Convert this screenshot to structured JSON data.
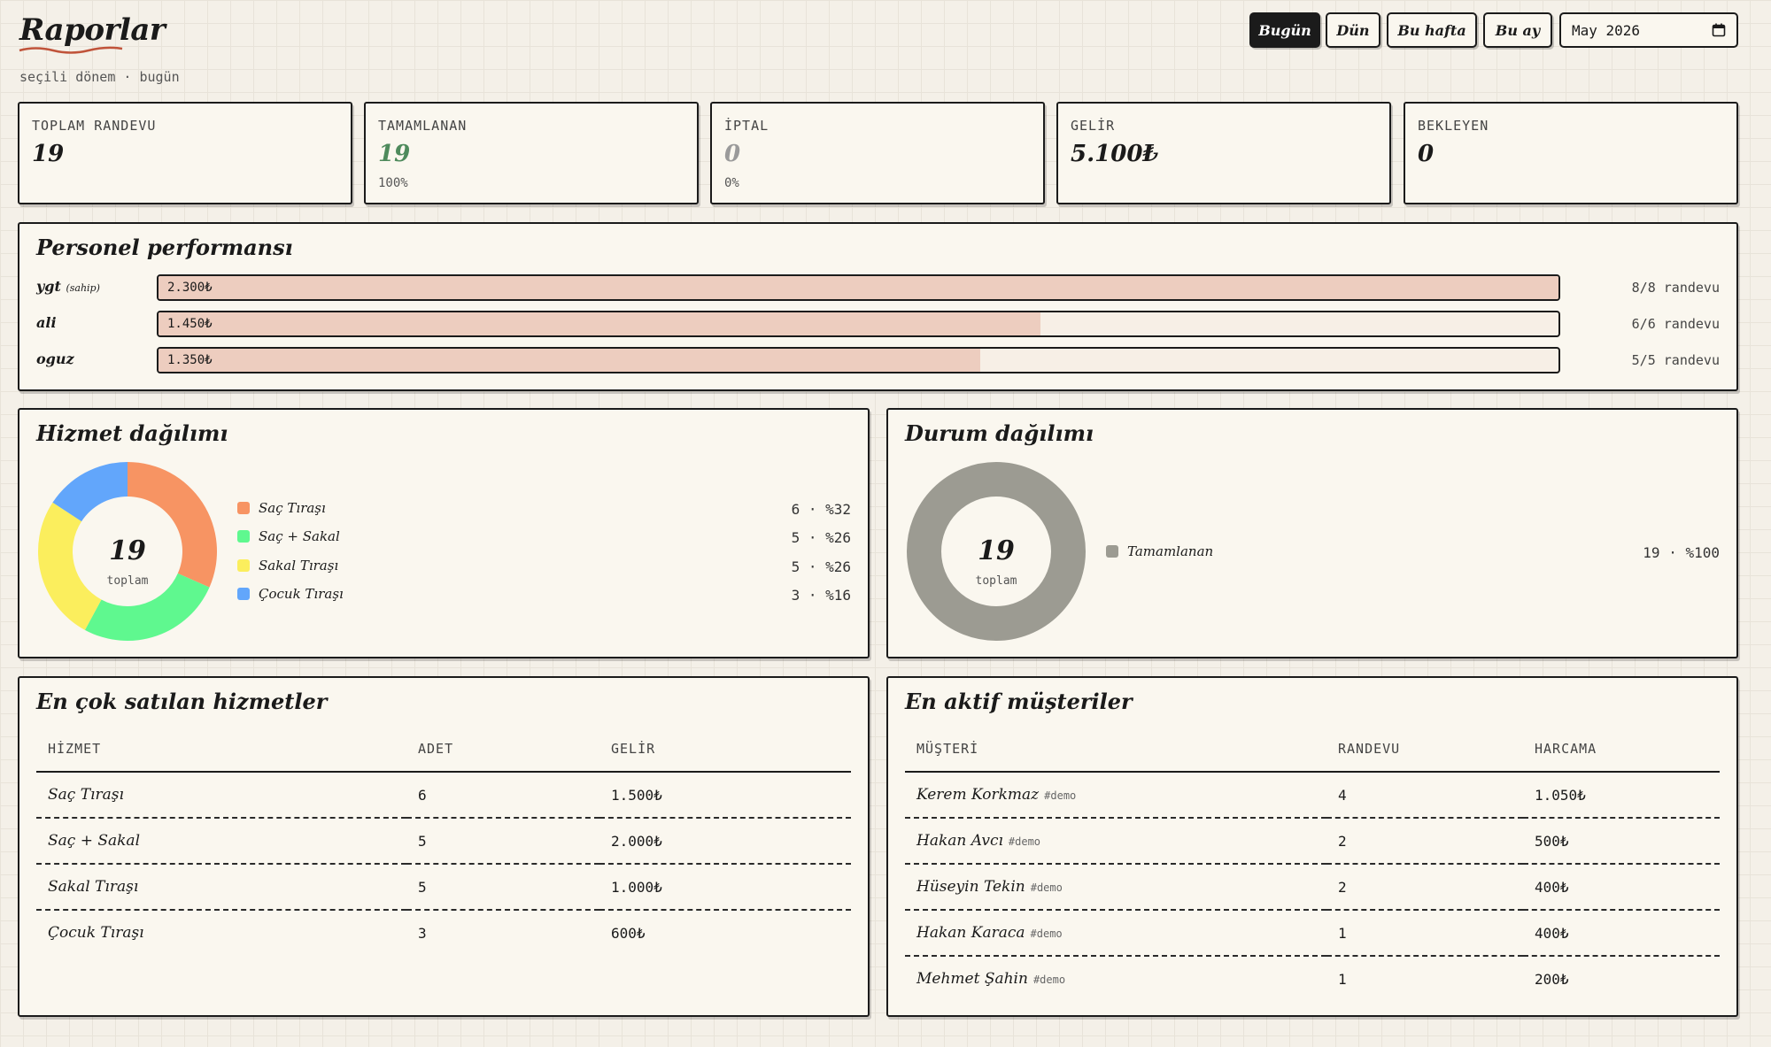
{
  "header": {
    "title": "Raporlar",
    "subtitle": "seçili dönem · bugün",
    "accent": "#c0533a"
  },
  "controls": {
    "buttons": [
      {
        "label": "Bugün",
        "active": true
      },
      {
        "label": "Dün",
        "active": false
      },
      {
        "label": "Bu hafta",
        "active": false
      },
      {
        "label": "Bu ay",
        "active": false
      }
    ],
    "date_value": "May 2026",
    "calendar_icon": "calendar-icon"
  },
  "stats": [
    {
      "label": "TOPLAM RANDEVU",
      "value": "19",
      "sub": "",
      "color": "#1a1a1a"
    },
    {
      "label": "TAMAMLANAN",
      "value": "19",
      "sub": "100%",
      "color": "#4e8a5c"
    },
    {
      "label": "İPTAL",
      "value": "0",
      "sub": "0%",
      "color": "#9a9a9a"
    },
    {
      "label": "GELİR",
      "value": "5.100₺",
      "sub": "",
      "color": "#1a1a1a"
    },
    {
      "label": "BEKLEYEN",
      "value": "0",
      "sub": "",
      "color": "#1a1a1a"
    }
  ],
  "performance": {
    "title": "Personel performansı",
    "rows": [
      {
        "name": "ygt",
        "role": "(sahip)",
        "amount": "2.300₺",
        "fraction": 1.0,
        "count": "8/8 randevu"
      },
      {
        "name": "ali",
        "role": "",
        "amount": "1.450₺",
        "fraction": 0.63,
        "count": "6/6 randevu"
      },
      {
        "name": "oguz",
        "role": "",
        "amount": "1.350₺",
        "fraction": 0.587,
        "count": "5/5 randevu"
      }
    ]
  },
  "service_dist": {
    "title": "Hizmet dağılımı",
    "center_value": "19",
    "center_label": "toplam",
    "items": [
      {
        "label": "Saç Tıraşı",
        "count": 6,
        "value": "6 · %32",
        "color": "#f79463"
      },
      {
        "label": "Saç + Sakal",
        "count": 5,
        "value": "5 · %26",
        "color": "#5ff88f"
      },
      {
        "label": "Sakal Tıraşı",
        "count": 5,
        "value": "5 · %26",
        "color": "#fbee5d"
      },
      {
        "label": "Çocuk Tıraşı",
        "count": 3,
        "value": "3 · %16",
        "color": "#62a6fb"
      }
    ]
  },
  "status_dist": {
    "title": "Durum dağılımı",
    "center_value": "19",
    "center_label": "toplam",
    "items": [
      {
        "label": "Tamamlanan",
        "count": 19,
        "value": "19 · %100",
        "color": "#9c9b92"
      }
    ]
  },
  "top_services": {
    "title": "En çok satılan hizmetler",
    "columns": [
      "HİZMET",
      "ADET",
      "GELİR"
    ],
    "rows": [
      [
        "Saç Tıraşı",
        "6",
        "1.500₺"
      ],
      [
        "Saç + Sakal",
        "5",
        "2.000₺"
      ],
      [
        "Sakal Tıraşı",
        "5",
        "1.000₺"
      ],
      [
        "Çocuk Tıraşı",
        "3",
        "600₺"
      ]
    ]
  },
  "top_customers": {
    "title": "En aktif müşteriler",
    "columns": [
      "MÜŞTERİ",
      "RANDEVU",
      "HARCAMA"
    ],
    "rows": [
      {
        "name": "Kerem Korkmaz",
        "tag": "#demo",
        "count": "4",
        "spend": "1.050₺"
      },
      {
        "name": "Hakan Avcı",
        "tag": "#demo",
        "count": "2",
        "spend": "500₺"
      },
      {
        "name": "Hüseyin Tekin",
        "tag": "#demo",
        "count": "2",
        "spend": "400₺"
      },
      {
        "name": "Hakan Karaca",
        "tag": "#demo",
        "count": "1",
        "spend": "400₺"
      },
      {
        "name": "Mehmet Şahin",
        "tag": "#demo",
        "count": "1",
        "spend": "200₺"
      }
    ]
  }
}
